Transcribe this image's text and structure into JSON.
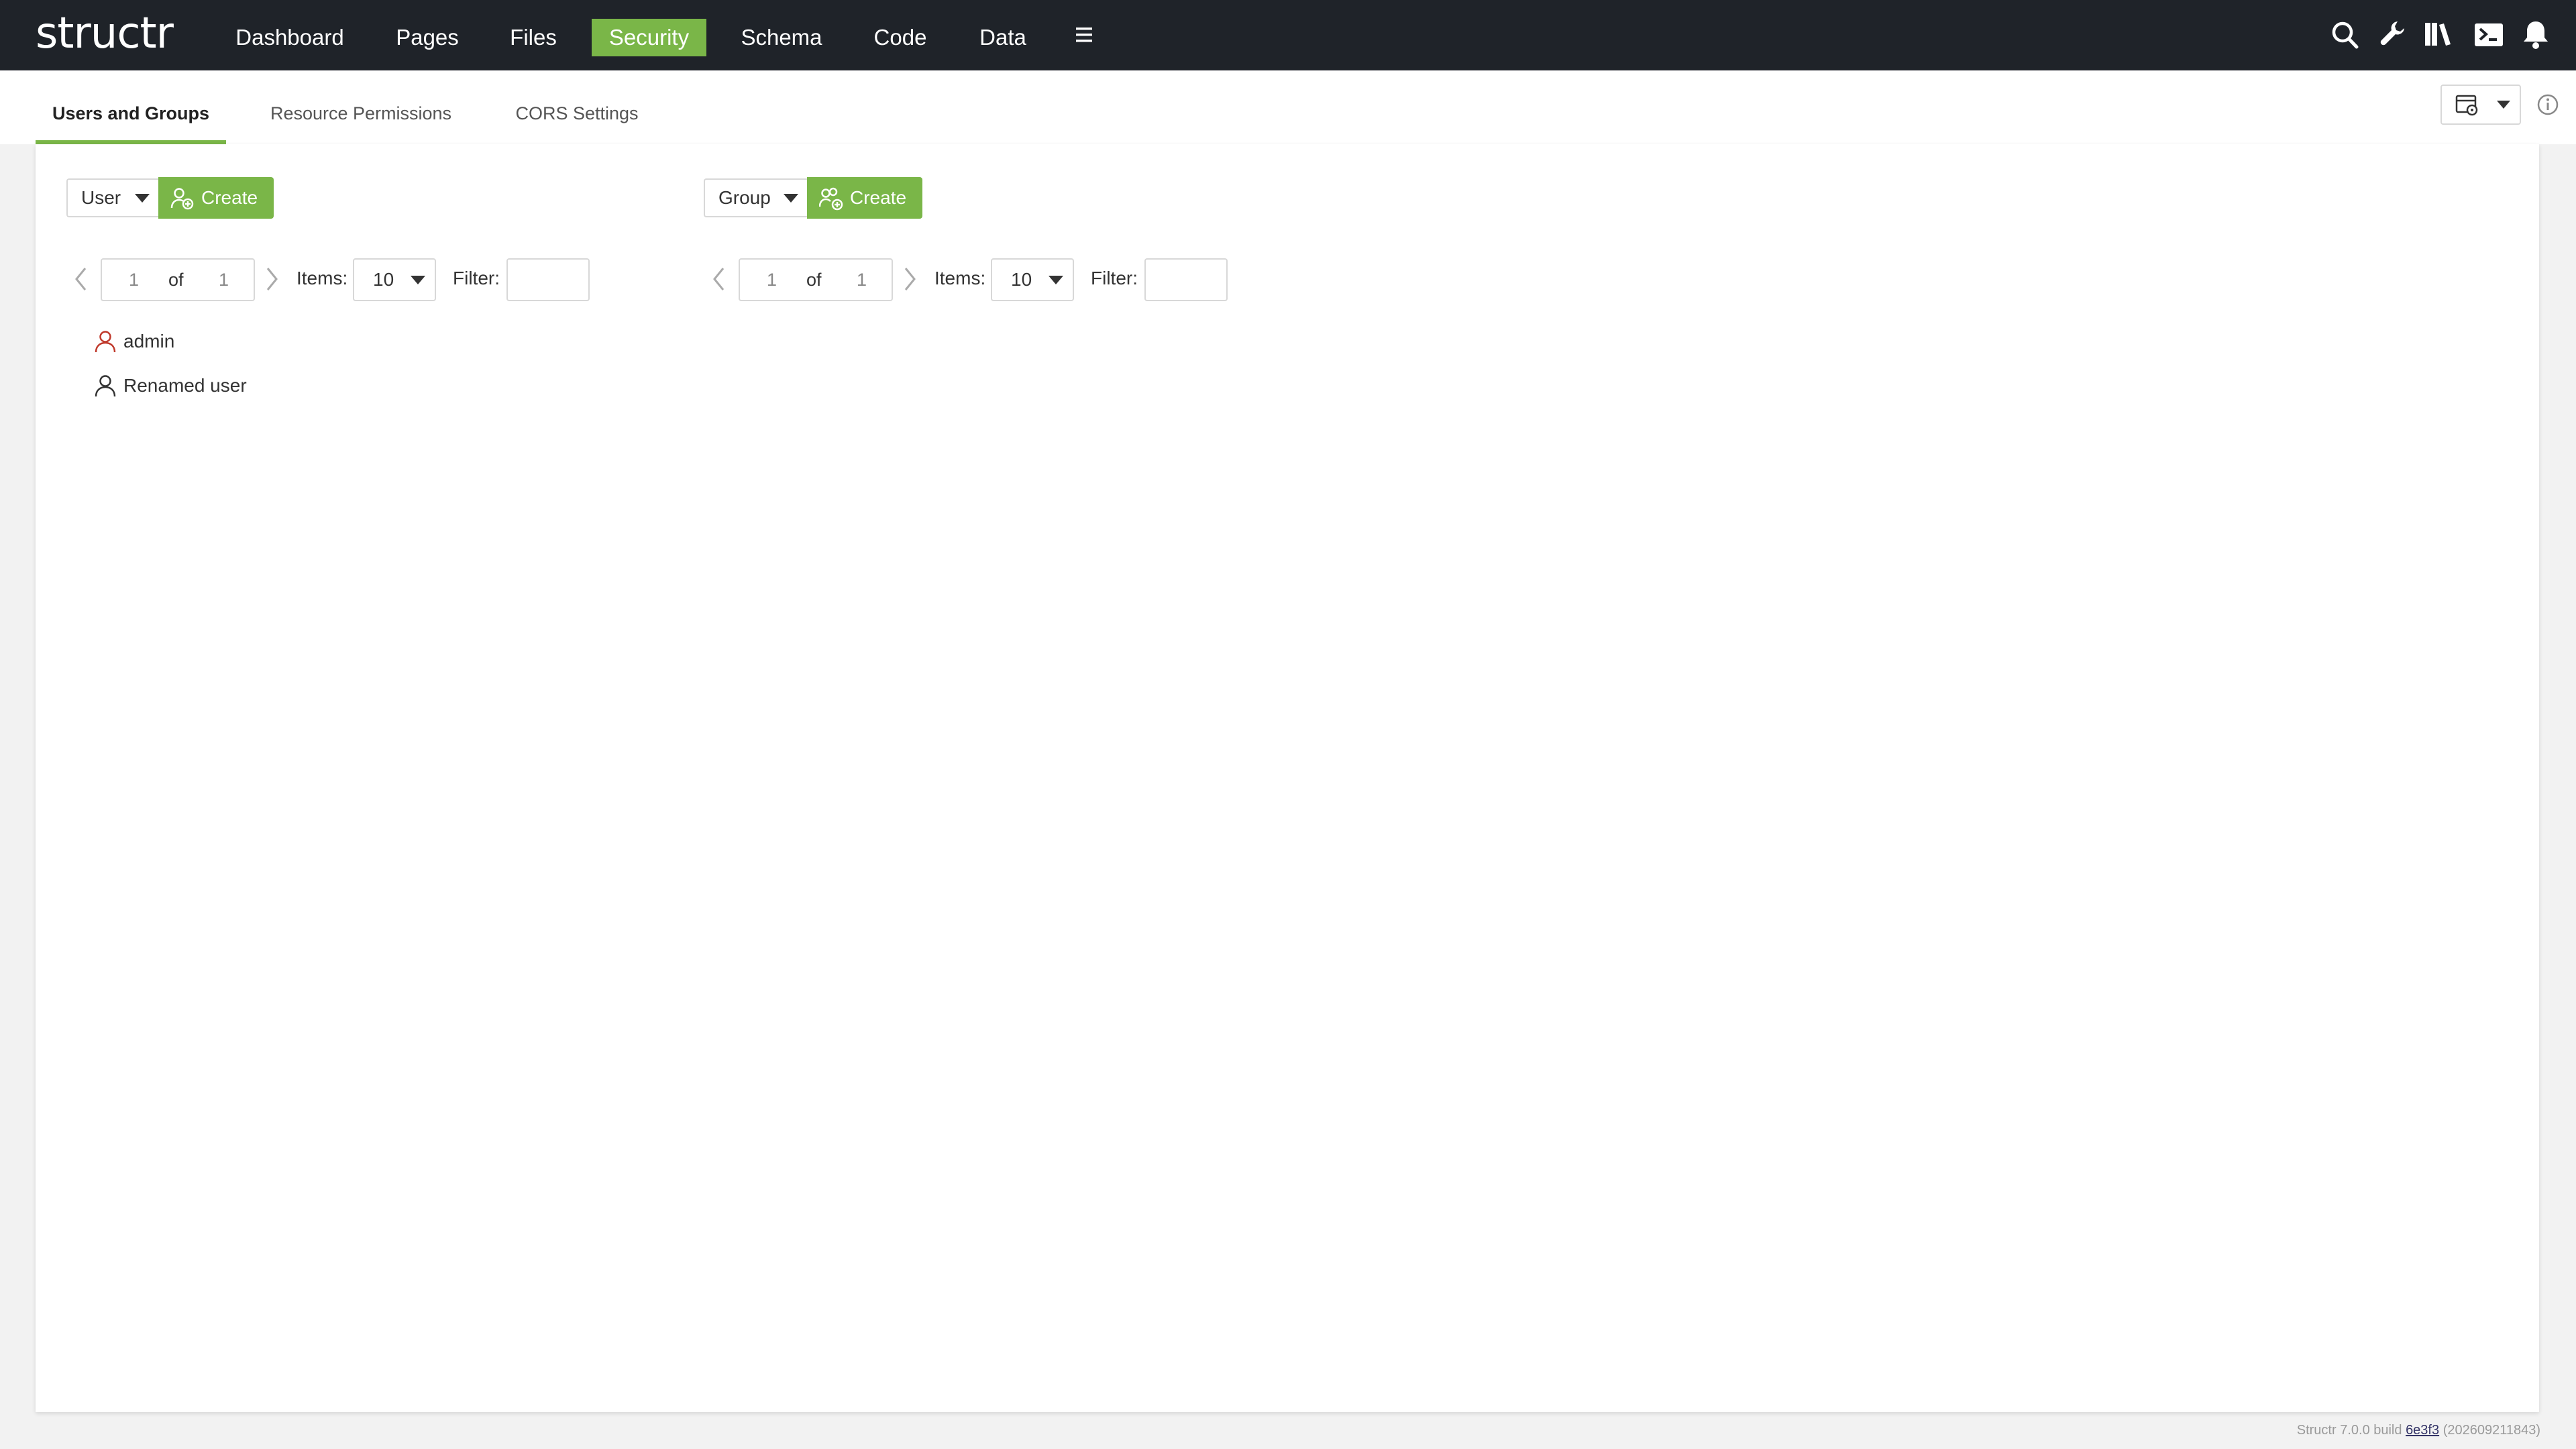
{
  "app": {
    "logo": "structr"
  },
  "nav": {
    "items": [
      {
        "label": "Dashboard",
        "active": false
      },
      {
        "label": "Pages",
        "active": false
      },
      {
        "label": "Files",
        "active": false
      },
      {
        "label": "Security",
        "active": true
      },
      {
        "label": "Schema",
        "active": false
      },
      {
        "label": "Code",
        "active": false
      },
      {
        "label": "Data",
        "active": false
      }
    ],
    "menu_icon": "hamburger-icon",
    "right_icons": [
      "search-icon",
      "wrench-icon",
      "book-icon",
      "terminal-icon",
      "bell-icon"
    ]
  },
  "tabs": [
    {
      "label": "Users and Groups",
      "active": true
    },
    {
      "label": "Resource Permissions",
      "active": false
    },
    {
      "label": "CORS Settings",
      "active": false
    }
  ],
  "users_panel": {
    "type_select": "User",
    "create_label": "Create",
    "pager": {
      "page": "1",
      "of": "of",
      "total": "1"
    },
    "items_label": "Items:",
    "items_value": "10",
    "filter_label": "Filter:",
    "filter_value": "",
    "users": [
      {
        "name": "admin",
        "admin": true
      },
      {
        "name": "Renamed user",
        "admin": false
      }
    ]
  },
  "groups_panel": {
    "type_select": "Group",
    "create_label": "Create",
    "pager": {
      "page": "1",
      "of": "of",
      "total": "1"
    },
    "items_label": "Items:",
    "items_value": "10",
    "filter_label": "Filter:",
    "filter_value": ""
  },
  "footer": {
    "prefix": "Structr 7.0.0 build",
    "build_link": "6e3f3",
    "suffix": "(202609211843)"
  },
  "colors": {
    "accent": "#7ab648",
    "header_bg": "#1f2329",
    "admin_icon": "#c0392b"
  }
}
